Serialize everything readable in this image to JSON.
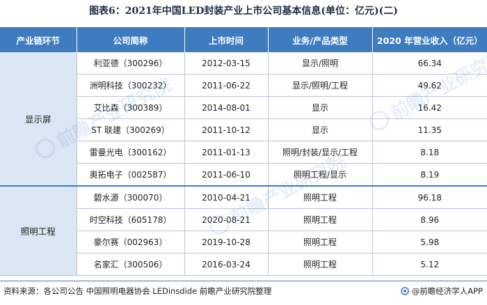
{
  "title": "图表6：2021年中国LED封装产业上市公司基本信息(单位：亿元)(二)",
  "table": {
    "headers": [
      "产业链环节",
      "公司简称",
      "上市时间",
      "业务/产品类型",
      "2020 年营业收入（亿元）"
    ],
    "groups": [
      {
        "name": "显示屏",
        "rows": [
          [
            "利亚德（300296）",
            "2012-03-15",
            "显示/照明",
            "66.34"
          ],
          [
            "洲明科技（300232）",
            "2011-06-22",
            "显示/照明/工程",
            "49.62"
          ],
          [
            "艾比森（300389）",
            "2014-08-01",
            "显示",
            "16.42"
          ],
          [
            "ST 联建（300269）",
            "2011-10-12",
            "显示",
            "11.35"
          ],
          [
            "雷曼光电（300162）",
            "2011-01-13",
            "照明/封装/显示/工程",
            "8.18"
          ],
          [
            "奥拓电子（002587）",
            "2011-06-10",
            "照明工程/显示",
            "8.19"
          ]
        ]
      },
      {
        "name": "照明工程",
        "rows": [
          [
            "碧水源（300070）",
            "2010-04-21",
            "照明工程",
            "96.18"
          ],
          [
            "时空科技（605178）",
            "2020-08-21",
            "照明工程",
            "8.96"
          ],
          [
            "豪尔赛（002963）",
            "2019-10-28",
            "照明工程",
            "5.98"
          ],
          [
            "名家汇（300506）",
            "2016-03-24",
            "照明工程",
            "5.12"
          ]
        ]
      }
    ]
  },
  "footer": {
    "source": "资料来源：各公司公告 中国照明电器协会 LEDinsdide 前瞻产业研究院整理",
    "brand": "@前瞻经济学人APP"
  },
  "watermark": {
    "text": "前瞻产业研究院"
  },
  "colors": {
    "header_bg": "#3f7cbf",
    "group_bg": "#dbe6f4",
    "border": "#b8c6d8"
  }
}
